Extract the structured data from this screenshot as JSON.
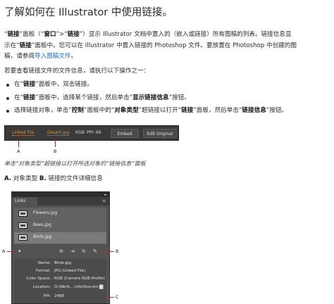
{
  "title": "了解如何在 Illustrator 中使用链接。",
  "intro": {
    "l1_q1": "“",
    "l1_b1": "链接",
    "l1_t1": "”面板（“",
    "l1_b2": "窗口",
    "l1_t2": "”>“",
    "l1_b3": "链接",
    "l1_t3": "”）显示 Illustrator 文档中置入的（嵌入或链接）所有图稿的列表。链接信息显",
    "l2_t1": "示在“",
    "l2_b1": "链接",
    "l2_t2": "”面板中。您可以在 Illustrator 中置入链接的 Photoshop 文件。要放置在 Photoshop 中创建的图",
    "l3_t1": "稿，请参阅",
    "l3_link": "导入图稿文件",
    "l3_t2": "。"
  },
  "steps_intro": "若要查看链接文件的文件信息，请执行以下操作之一：",
  "bullets": {
    "b1_t1": "在“",
    "b1_b1": "链接",
    "b1_t2": "”面板中，双击链接。",
    "b2_t1": "在“",
    "b2_b1": "链接",
    "b2_t2": "”面板中，选择某个链接，然后单击“",
    "b2_b2": "显示链接信息",
    "b2_t3": "”按钮。",
    "b3_t1": "选择链接对象，单击“",
    "b3_b1": "控制",
    "b3_t2": "”面板中的“",
    "b3_b2": "对象类型",
    "b3_t3": "”超链接以打开“",
    "b3_b3": "链接",
    "b3_t4": "”面板，然后单击“",
    "b3_b4": "链接信息",
    "b3_t5": "”按钮。"
  },
  "control_panel": {
    "linked_file": "Linked File",
    "file_name": "Desert.jpg",
    "color": "RGB",
    "ppi": "PPI: 96",
    "embed_button": "Embed",
    "edit_original_button": "Edit Original",
    "callout_a": "A",
    "callout_b": "B"
  },
  "caption": "单击“对象类型”超链接以打开所选对象的“链接信息”面板",
  "legend": {
    "a": "A.",
    "a_text": " 对象类型 ",
    "b": "B.",
    "b_text": " 链接的文件详细信息"
  },
  "links_panel": {
    "collapse": "▸▸",
    "tab": "Links",
    "menu": "≡",
    "items": [
      "Flowers.jpg",
      "Bees.jpg",
      "Birds.jpg"
    ],
    "toolbar_icons": [
      "show-info-icon",
      "relink-icon",
      "go-to-link-icon",
      "update-link-icon",
      "edit-original-icon"
    ],
    "info": [
      {
        "k": "Name:",
        "v": "Birds.jpg"
      },
      {
        "k": "Format:",
        "v": "JPG (Linked File)"
      },
      {
        "k": "Color Space:",
        "v": "RGB (Camera RGB Profile)"
      },
      {
        "k": "Location:",
        "v": "D:\\Work...-info\\illus.erc"
      },
      {
        "k": "PPI:",
        "v": "2488"
      }
    ],
    "callout_a": "A",
    "callout_b": "B",
    "callout_c": "C"
  },
  "colors": {
    "accent_red": "#c0282b",
    "link_blue": "#1473e6",
    "file_orange": "#e8912c"
  }
}
